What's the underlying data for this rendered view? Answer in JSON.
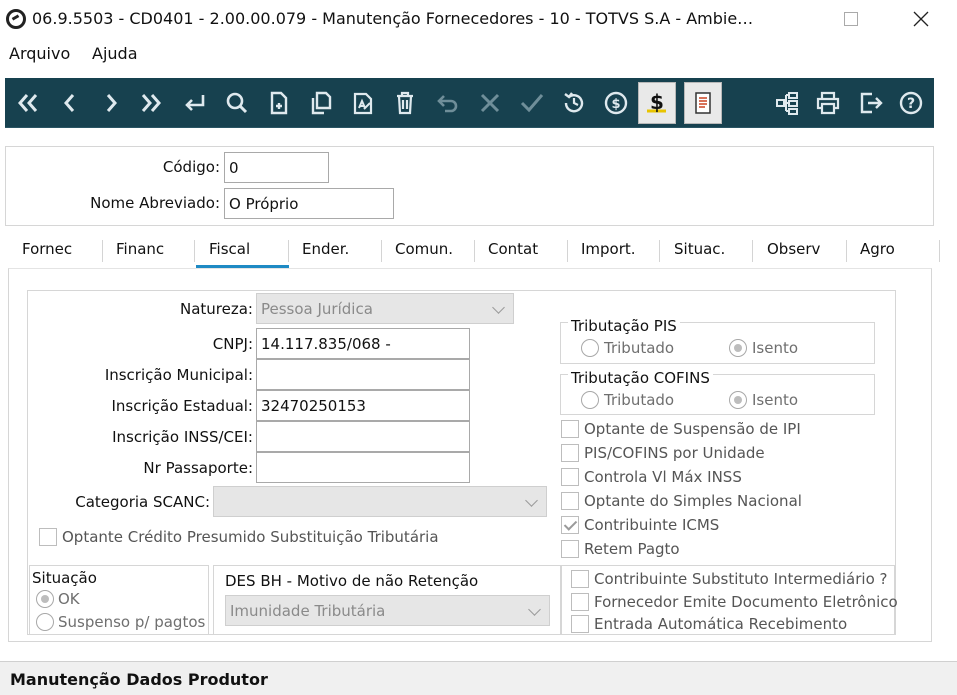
{
  "window": {
    "title": "06.9.5503 - CD0401 - 2.00.00.079 - Manutenção Fornecedores - 10 - TOTVS S.A - Ambie…"
  },
  "menu": {
    "items": [
      "Arquivo",
      "Ajuda"
    ]
  },
  "toolbar": {
    "icons": [
      "first-icon",
      "previous-icon",
      "next-icon",
      "last-icon",
      "goto-icon",
      "search-icon",
      "new-icon",
      "copy-icon",
      "edit-icon",
      "delete-icon",
      "undo-icon",
      "cancel-icon",
      "save-icon",
      "history-icon",
      "currency-icon",
      "financial-icon",
      "report-icon",
      "tree-icon",
      "print-icon",
      "exit-icon",
      "help-icon"
    ]
  },
  "header": {
    "codigo_label": "Código:",
    "codigo_value": "0",
    "nome_label": "Nome Abreviado:",
    "nome_value": "O Próprio"
  },
  "tabs": [
    "Fornec",
    "Financ",
    "Fiscal",
    "Ender.",
    "Comun.",
    "Contat",
    "Import.",
    "Situac.",
    "Observ",
    "Agro"
  ],
  "active_tab": "Fiscal",
  "fiscal": {
    "natureza_label": "Natureza:",
    "natureza_value": "Pessoa Jurídica",
    "cnpj_label": "CNPJ:",
    "cnpj_value": "14.117.835/068 -",
    "insc_municipal_label": "Inscrição Municipal:",
    "insc_municipal_value": "",
    "insc_estadual_label": "Inscrição Estadual:",
    "insc_estadual_value": "32470250153",
    "insc_inss_label": "Inscrição INSS/CEI:",
    "insc_inss_value": "",
    "passaporte_label": "Nr Passaporte:",
    "passaporte_value": "",
    "categoria_label": "Categoria SCANC:",
    "categoria_value": "",
    "optante_credito_label": "Optante Crédito Presumido Substituição Tributária",
    "trib_pis": {
      "title": "Tributação PIS",
      "opt1": "Tributado",
      "opt2": "Isento",
      "selected": "Isento"
    },
    "trib_cofins": {
      "title": "Tributação COFINS",
      "opt1": "Tributado",
      "opt2": "Isento",
      "selected": "Isento"
    },
    "checks": [
      {
        "label": "Optante de Suspensão de IPI",
        "checked": false
      },
      {
        "label": "PIS/COFINS por Unidade",
        "checked": false
      },
      {
        "label": "Controla Vl Máx INSS",
        "checked": false
      },
      {
        "label": "Optante do Simples Nacional",
        "checked": false
      },
      {
        "label": "Contribuinte ICMS",
        "checked": true
      },
      {
        "label": "Retem Pagto",
        "checked": false
      }
    ],
    "situacao": {
      "title": "Situação",
      "opt1": "OK",
      "opt2": "Suspenso p/ pagtos",
      "selected": "OK"
    },
    "des_bh": {
      "title": "DES BH - Motivo de não Retenção",
      "value": "Imunidade Tributária"
    },
    "checks2": [
      {
        "label": "Contribuinte Substituto Intermediário ?",
        "checked": false
      },
      {
        "label": "Fornecedor Emite Documento Eletrônico",
        "checked": false
      },
      {
        "label": "Entrada Automática Recebimento",
        "checked": false
      }
    ]
  },
  "status": {
    "text": "Manutenção Dados Produtor"
  },
  "colors": {
    "toolbar_bg": "#17414f",
    "tab_accent": "#1e8ac4"
  }
}
